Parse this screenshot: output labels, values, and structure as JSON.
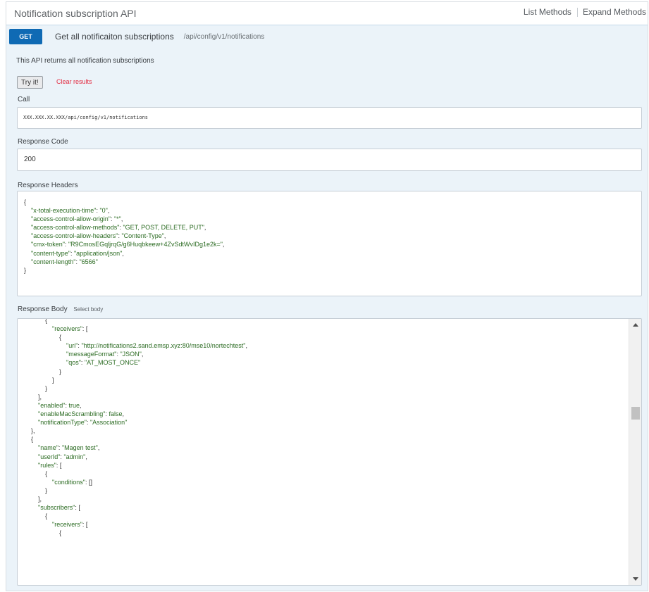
{
  "title": "Notification subscription API",
  "top_links": [
    "List Methods",
    "Expand Methods"
  ],
  "operation": {
    "method": "GET",
    "summary": "Get all notificaiton subscriptions",
    "path": "/api/config/v1/notifications",
    "description": "This API returns all notification subscriptions"
  },
  "actions": {
    "try": "Try it!",
    "clear": "Clear results"
  },
  "call": {
    "label": "Call",
    "value": "XXX.XXX.XX.XXX/api/config/v1/notifications"
  },
  "response_code": {
    "label": "Response Code",
    "value": "200"
  },
  "response_headers": {
    "label": "Response Headers",
    "lines": [
      [
        "{"
      ],
      [
        "    ",
        "\"x-total-execution-time\"",
        ": ",
        "\"0\"",
        ","
      ],
      [
        "    ",
        "\"access-control-allow-origin\"",
        ": ",
        "\"*\"",
        ","
      ],
      [
        "    ",
        "\"access-control-allow-methods\"",
        ": ",
        "\"GET, POST, DELETE, PUT\"",
        ","
      ],
      [
        "    ",
        "\"access-control-allow-headers\"",
        ": ",
        "\"Content-Type\"",
        ","
      ],
      [
        "    ",
        "\"cmx-token\"",
        ": ",
        "\"R9CmosEGqljrqG/g6Huqbkeew+4ZvSdtWvIDg1e2k=\"",
        ","
      ],
      [
        "    ",
        "\"content-type\"",
        ": ",
        "\"application/json\"",
        ","
      ],
      [
        "    ",
        "\"content-length\"",
        ": ",
        "\"6566\""
      ],
      [
        "}"
      ]
    ]
  },
  "response_body": {
    "label": "Response Body",
    "select_label": "Select body",
    "lines": [
      [
        "            {"
      ],
      [
        "                ",
        "\"receivers\"",
        ": ["
      ],
      [
        "                    {"
      ],
      [
        "                        ",
        "\"uri\"",
        ": ",
        "\"http://notifications2.sand.emsp.xyz:80/mse10/nortechtest\"",
        ","
      ],
      [
        "                        ",
        "\"messageFormat\"",
        ": ",
        "\"JSON\"",
        ","
      ],
      [
        "                        ",
        "\"qos\"",
        ": ",
        "\"AT_MOST_ONCE\""
      ],
      [
        "                    }"
      ],
      [
        "                ]"
      ],
      [
        "            }"
      ],
      [
        "        ],"
      ],
      [
        "        ",
        "\"enabled\"",
        ": ",
        "true",
        ","
      ],
      [
        "        ",
        "\"enableMacScrambling\"",
        ": ",
        "false",
        ","
      ],
      [
        "        ",
        "\"notificationType\"",
        ": ",
        "\"Association\""
      ],
      [
        "    },"
      ],
      [
        "    {"
      ],
      [
        "        ",
        "\"name\"",
        ": ",
        "\"Magen test\"",
        ","
      ],
      [
        "        ",
        "\"userId\"",
        ": ",
        "\"admin\"",
        ","
      ],
      [
        "        ",
        "\"rules\"",
        ": ["
      ],
      [
        "            {"
      ],
      [
        "                ",
        "\"conditions\"",
        ": []"
      ],
      [
        "            }"
      ],
      [
        "        ],"
      ],
      [
        "        ",
        "\"subscribers\"",
        ": ["
      ],
      [
        "            {"
      ],
      [
        "                ",
        "\"receivers\"",
        ": ["
      ],
      [
        "                    {"
      ]
    ]
  }
}
